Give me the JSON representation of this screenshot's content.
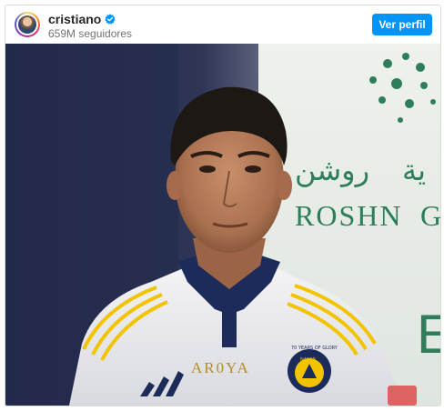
{
  "header": {
    "username": "cristiano",
    "followers": "659M seguidores",
    "follow_button": "Ver perfil"
  },
  "post": {
    "sign_text_arabic": "روشن",
    "sign_text_arabic_2": "ية",
    "sign_text_latin": "ROSHN",
    "sign_text_latin_2": "G",
    "sign_partial": "E",
    "jersey_sponsor": "AR0YA",
    "crest_top": "70 YEARS OF GLORY",
    "crest_name": "NASSR"
  },
  "colors": {
    "accent": "#0095f6",
    "verified": "#0095f6",
    "jersey_navy": "#1c2b5a",
    "jersey_yellow": "#f2c400",
    "sign_green": "#2e7d5b"
  },
  "icons": {
    "verified": "verified-badge-icon",
    "avatar": "profile-avatar"
  }
}
